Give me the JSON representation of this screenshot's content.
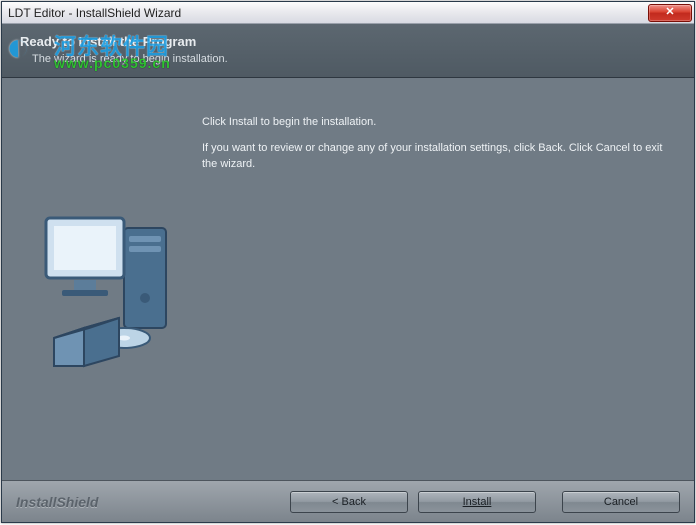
{
  "titlebar": {
    "title": "LDT Editor - InstallShield Wizard",
    "close_label": "✕"
  },
  "header": {
    "title": "Ready to Install the Program",
    "subtitle": "The wizard is ready to begin installation."
  },
  "content": {
    "line1": "Click Install to begin the installation.",
    "line2": "If you want to review or change any of your installation settings, click Back. Click Cancel to exit the wizard."
  },
  "footer": {
    "brand": "InstallShield",
    "back_label": "< Back",
    "install_label": "Install",
    "cancel_label": "Cancel"
  },
  "watermark": {
    "cn": "河东软件园",
    "url": "www.pc0359.cn"
  }
}
